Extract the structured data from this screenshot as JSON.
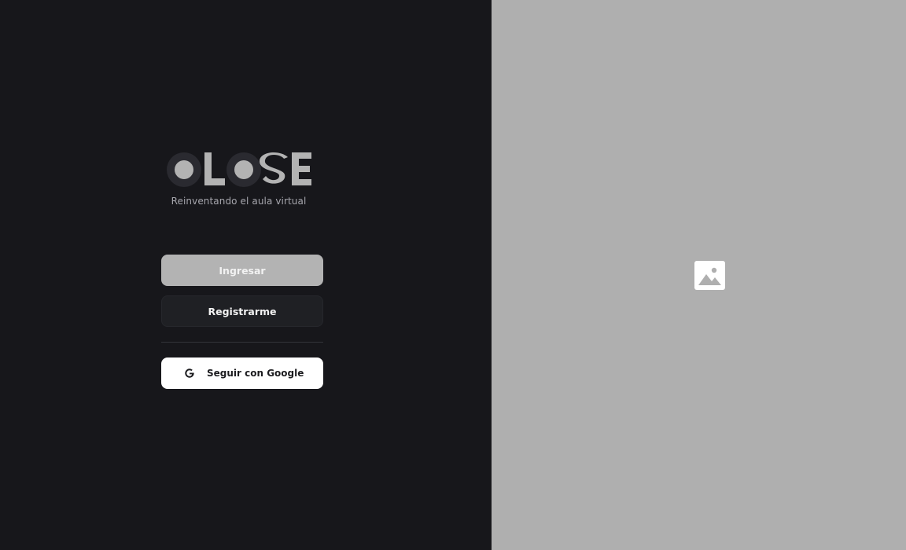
{
  "brand": {
    "logo_text": "CLOSE",
    "tagline": "Reinventando el aula virtual"
  },
  "actions": {
    "login_label": "Ingresar",
    "register_label": "Registrarme",
    "google_label": "Seguir con Google"
  },
  "icons": {
    "google": "google-g-icon",
    "image_placeholder": "image-icon"
  },
  "colors": {
    "left_bg": "#17171b",
    "right_bg": "#afafaf",
    "login_bg": "#b3b3b3",
    "register_bg": "#1f2024",
    "google_bg": "#ffffff"
  }
}
